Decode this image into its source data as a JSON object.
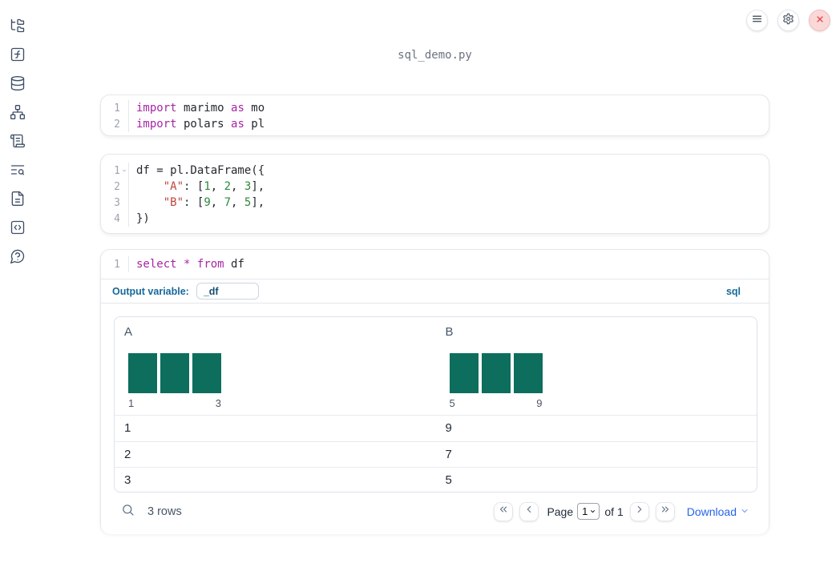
{
  "window": {
    "title": "sql_demo.py"
  },
  "topbar": {
    "buttons": [
      {
        "id": "menu",
        "icon": "hamburger-icon"
      },
      {
        "id": "settings",
        "icon": "gear-icon"
      },
      {
        "id": "close",
        "icon": "close-icon"
      }
    ]
  },
  "sidebar": {
    "items": [
      {
        "id": "file-explorer",
        "icon": "folder-tree-icon"
      },
      {
        "id": "functions",
        "icon": "function-square-icon"
      },
      {
        "id": "datasources",
        "icon": "database-icon"
      },
      {
        "id": "dependency-graph",
        "icon": "network-icon"
      },
      {
        "id": "changelog",
        "icon": "scroll-icon"
      },
      {
        "id": "logs",
        "icon": "list-search-icon"
      },
      {
        "id": "documentation",
        "icon": "file-text-icon"
      },
      {
        "id": "snippets",
        "icon": "code-square-icon"
      },
      {
        "id": "help",
        "icon": "help-bubble-icon"
      }
    ]
  },
  "cells": [
    {
      "id": "imports",
      "lines": [
        {
          "num": "1",
          "tokens": [
            {
              "t": "import",
              "c": "kw"
            },
            {
              "t": " marimo ",
              "c": "pl"
            },
            {
              "t": "as",
              "c": "kw"
            },
            {
              "t": " mo",
              "c": "pl"
            }
          ]
        },
        {
          "num": "2",
          "tokens": [
            {
              "t": "import",
              "c": "kw"
            },
            {
              "t": " polars ",
              "c": "pl"
            },
            {
              "t": "as",
              "c": "kw"
            },
            {
              "t": " pl",
              "c": "pl"
            }
          ]
        }
      ]
    },
    {
      "id": "dataframe",
      "lines": [
        {
          "num": "1",
          "fold": true,
          "tokens": [
            {
              "t": "df = pl.DataFrame({",
              "c": "pl"
            }
          ]
        },
        {
          "num": "2",
          "tokens": [
            {
              "t": "    ",
              "c": "pl"
            },
            {
              "t": "\"A\"",
              "c": "str"
            },
            {
              "t": ": [",
              "c": "pl"
            },
            {
              "t": "1",
              "c": "num"
            },
            {
              "t": ", ",
              "c": "pl"
            },
            {
              "t": "2",
              "c": "num"
            },
            {
              "t": ", ",
              "c": "pl"
            },
            {
              "t": "3",
              "c": "num"
            },
            {
              "t": "],",
              "c": "pl"
            }
          ]
        },
        {
          "num": "3",
          "tokens": [
            {
              "t": "    ",
              "c": "pl"
            },
            {
              "t": "\"B\"",
              "c": "str"
            },
            {
              "t": ": [",
              "c": "pl"
            },
            {
              "t": "9",
              "c": "num"
            },
            {
              "t": ", ",
              "c": "pl"
            },
            {
              "t": "7",
              "c": "num"
            },
            {
              "t": ", ",
              "c": "pl"
            },
            {
              "t": "5",
              "c": "num"
            },
            {
              "t": "],",
              "c": "pl"
            }
          ]
        },
        {
          "num": "4",
          "tokens": [
            {
              "t": "})",
              "c": "pl"
            }
          ]
        }
      ]
    },
    {
      "id": "sql",
      "lines": [
        {
          "num": "1",
          "tokens": [
            {
              "t": "select",
              "c": "kw"
            },
            {
              "t": " ",
              "c": "pl"
            },
            {
              "t": "*",
              "c": "kw"
            },
            {
              "t": " ",
              "c": "pl"
            },
            {
              "t": "from",
              "c": "kw"
            },
            {
              "t": " df",
              "c": "pl"
            }
          ]
        }
      ],
      "footer": {
        "output_variable_label": "Output variable:",
        "output_variable_value": "_df",
        "language": "sql"
      }
    }
  ],
  "table": {
    "columns": [
      {
        "name": "A",
        "histogram": {
          "bars": [
            1,
            1,
            1
          ],
          "min_label": "1",
          "max_label": "3"
        }
      },
      {
        "name": "B",
        "histogram": {
          "bars": [
            1,
            1,
            1
          ],
          "min_label": "5",
          "max_label": "9"
        }
      }
    ],
    "rows": [
      [
        "1",
        "9"
      ],
      [
        "2",
        "7"
      ],
      [
        "3",
        "5"
      ]
    ],
    "footer": {
      "row_count": "3 rows",
      "page_label": "Page",
      "page_value": "1",
      "of_label": "of 1",
      "download_label": "Download"
    }
  },
  "colors": {
    "histogram_bar": "#0d6e5e",
    "sql_accent": "#17689b",
    "link_blue": "#2563eb",
    "keyword": "#a626a4",
    "string": "#c0443c",
    "number": "#2b8a3e",
    "close_red": "#e5484d"
  }
}
